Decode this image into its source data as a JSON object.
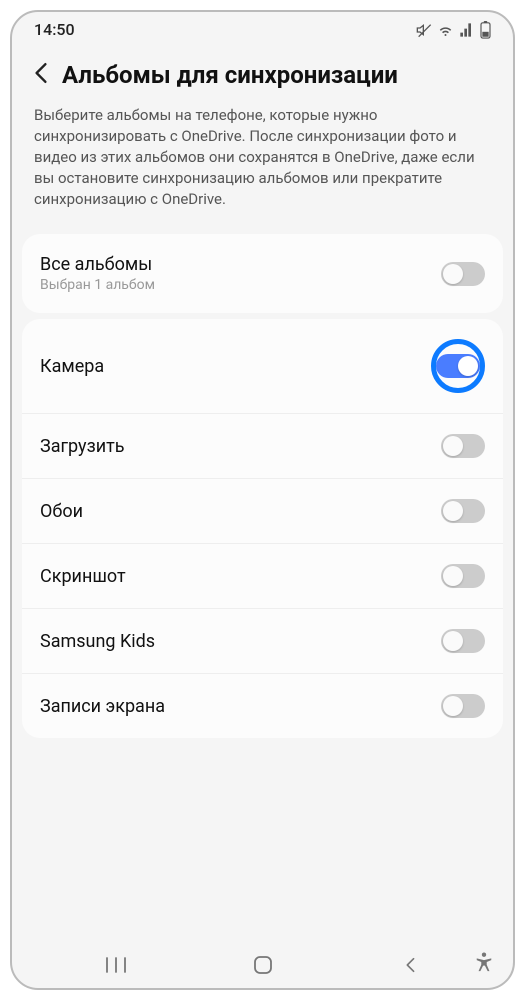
{
  "status": {
    "time": "14:50"
  },
  "header": {
    "title": "Альбомы для синхронизации",
    "description": "Выберите альбомы на телефоне, которые нужно синхронизировать с OneDrive. После синхронизации фото и видео из этих альбомов они сохранятся в OneDrive, даже если вы остановите синхронизацию альбомов или прекратите синхронизацию с OneDrive."
  },
  "all_albums": {
    "label": "Все альбомы",
    "sub": "Выбран 1 альбом",
    "on": false
  },
  "albums": [
    {
      "label": "Камера",
      "on": true,
      "highlight": true
    },
    {
      "label": "Загрузить",
      "on": false,
      "highlight": false
    },
    {
      "label": "Обои",
      "on": false,
      "highlight": false
    },
    {
      "label": "Скриншот",
      "on": false,
      "highlight": false
    },
    {
      "label": "Samsung Kids",
      "on": false,
      "highlight": false
    },
    {
      "label": "Записи экрана",
      "on": false,
      "highlight": false
    }
  ]
}
